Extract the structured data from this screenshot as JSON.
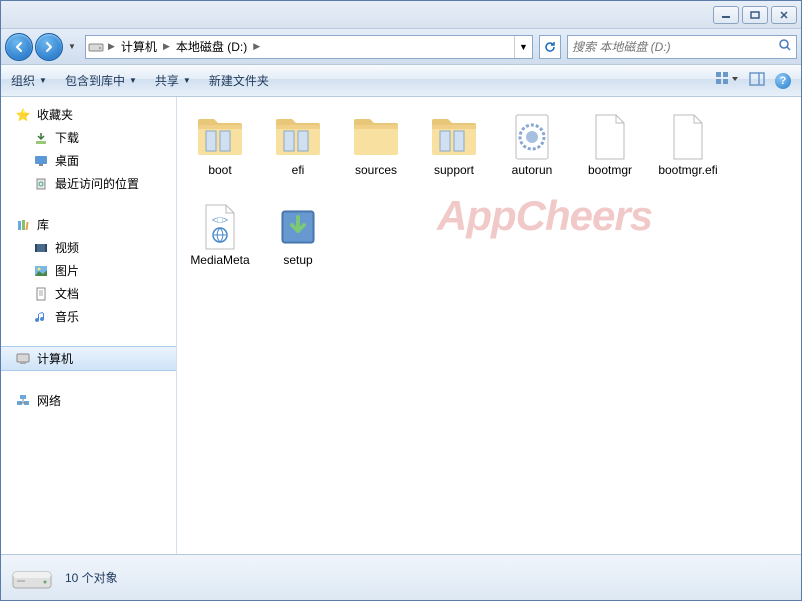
{
  "breadcrumb": {
    "computer": "计算机",
    "drive": "本地磁盘 (D:)"
  },
  "search": {
    "placeholder": "搜索 本地磁盘 (D:)"
  },
  "toolbar": {
    "organize": "组织",
    "include": "包含到库中",
    "share": "共享",
    "newfolder": "新建文件夹"
  },
  "sidebar": {
    "favorites": "收藏夹",
    "downloads": "下载",
    "desktop": "桌面",
    "recent": "最近访问的位置",
    "libraries": "库",
    "videos": "视频",
    "pictures": "图片",
    "documents": "文档",
    "music": "音乐",
    "computer": "计算机",
    "network": "网络"
  },
  "files": {
    "boot": "boot",
    "efi": "efi",
    "sources": "sources",
    "support": "support",
    "autorun": "autorun",
    "bootmgr": "bootmgr",
    "bootmgrefi": "bootmgr.efi",
    "mediameta": "MediaMeta",
    "setup": "setup"
  },
  "status": {
    "count": "10 个对象"
  },
  "watermark": "AppCheers"
}
